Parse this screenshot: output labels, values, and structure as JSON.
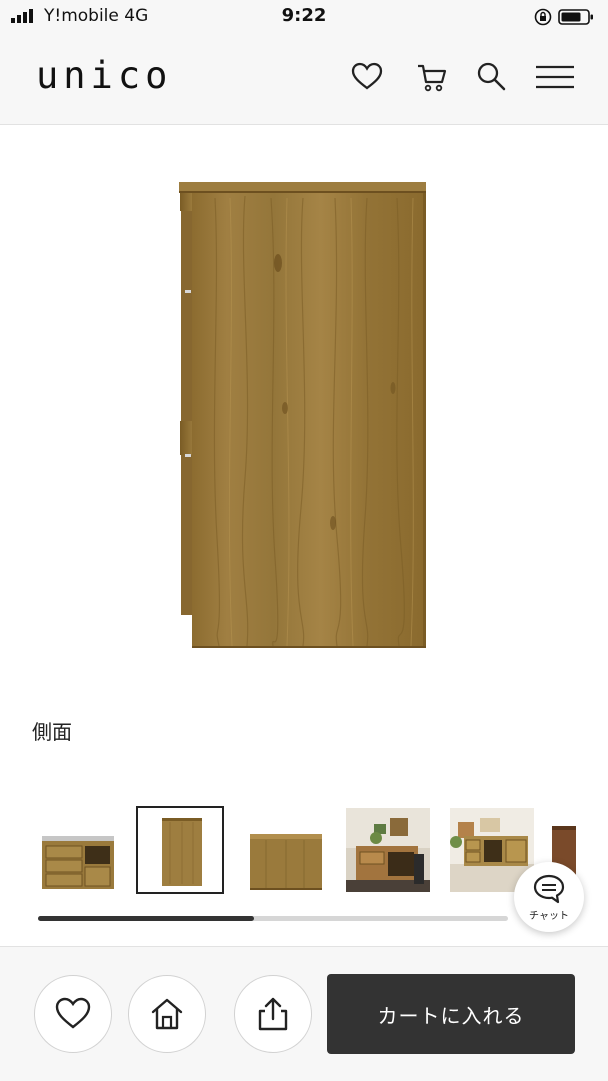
{
  "status_bar": {
    "carrier": "Y!mobile  4G",
    "time": "9:22"
  },
  "header": {
    "logo": "unico",
    "icons": [
      "heart-icon",
      "cart-icon",
      "search-icon",
      "menu-icon"
    ]
  },
  "product": {
    "image_caption": "側面",
    "gallery": {
      "thumbnails": [
        {
          "icon": "sideboard-front-thumbnail",
          "active": false
        },
        {
          "icon": "sideboard-side-thumbnail",
          "active": true
        },
        {
          "icon": "sideboard-back-thumbnail",
          "active": false
        },
        {
          "icon": "room-scene-thumbnail",
          "active": false
        },
        {
          "icon": "room-scene-shelf-thumbnail",
          "active": false
        },
        {
          "icon": "partial-thumbnail",
          "active": false
        }
      ],
      "scroll_progress": 0.46
    }
  },
  "chat": {
    "label": "チャット",
    "icon": "chat-bubble-icon"
  },
  "bottom_bar": {
    "buttons": [
      "heart-icon",
      "home-icon",
      "share-icon"
    ],
    "cart_label": "カートに入れる"
  },
  "colors": {
    "wood": "#9a7a3c",
    "dark_button": "#333333",
    "bar_background": "#f7f7f7"
  }
}
